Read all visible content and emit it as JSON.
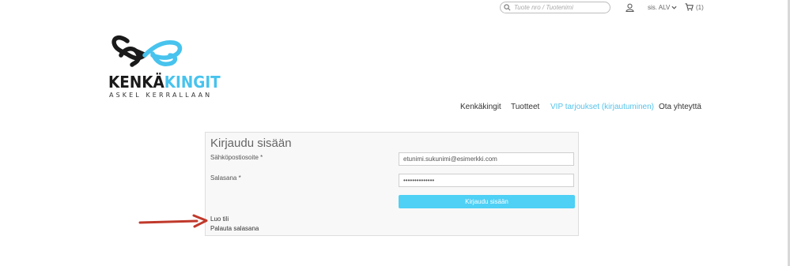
{
  "header": {
    "search_placeholder": "Tuote nro / Tuotenimi",
    "vat_label": "sis. ALV",
    "cart_count": "(1)"
  },
  "logo": {
    "name_part1": "KENKÄ",
    "name_part2": "KINGIT",
    "tagline": "ASKEL KERRALLAAN",
    "colors": {
      "dark": "#1a1a1a",
      "blue": "#47c3ee"
    }
  },
  "nav": {
    "items": [
      {
        "label": "Kenkäkingit"
      },
      {
        "label": "Tuotteet"
      },
      {
        "label": "VIP tarjoukset (kirjautuminen)"
      },
      {
        "label": "Ota yhteyttä"
      }
    ]
  },
  "login": {
    "title": "Kirjaudu sisään",
    "email_label": "Sähköpostiosoite *",
    "email_value": "etunimi.sukunimi@esimerkki.com",
    "password_label": "Salasana *",
    "password_value": "••••••••••••••",
    "submit_label": "Kirjaudu sisään",
    "create_account": "Luo tili",
    "reset_password": "Palauta salasana"
  },
  "colors": {
    "accent": "#4fd0f5",
    "nav_active": "#55c3ea",
    "annotation_arrow": "#c0392b"
  }
}
